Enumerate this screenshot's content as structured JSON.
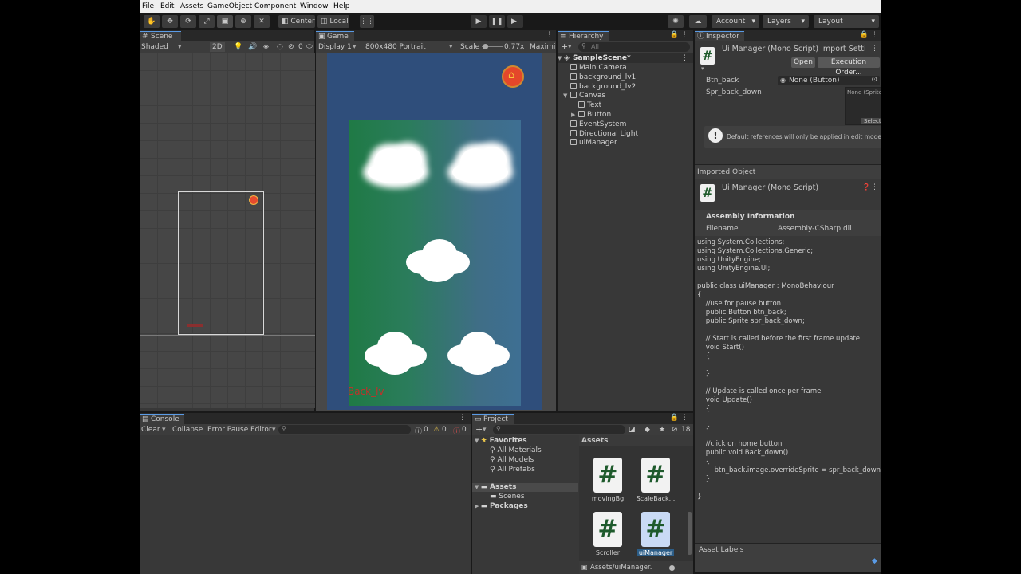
{
  "menu": [
    "File",
    "Edit",
    "Assets",
    "GameObject",
    "Component",
    "Window",
    "Help"
  ],
  "toolbar": {
    "pivot": "Center",
    "space": "Local",
    "account": "Account",
    "layers": "Layers",
    "layout": "Layout"
  },
  "scene": {
    "tab": "Scene",
    "shading": "Shaded",
    "mode_2d": "2D",
    "gizmo_count": "0"
  },
  "game": {
    "tab": "Game",
    "display": "Display 1",
    "resolution": "800x480 Portrait",
    "scale_label": "Scale",
    "scale_value": "0.77x",
    "maximize": "Maximi",
    "back_label": "Back_lv"
  },
  "hierarchy": {
    "tab": "Hierarchy",
    "search_placeholder": "All",
    "scene_name": "SampleScene*",
    "items": [
      {
        "label": "Main Camera",
        "depth": 1,
        "expand": ""
      },
      {
        "label": "background_lv1",
        "depth": 1,
        "expand": ""
      },
      {
        "label": "background_lv2",
        "depth": 1,
        "expand": ""
      },
      {
        "label": "Canvas",
        "depth": 1,
        "expand": "▼"
      },
      {
        "label": "Text",
        "depth": 2,
        "expand": ""
      },
      {
        "label": "Button",
        "depth": 2,
        "expand": "▶"
      },
      {
        "label": "EventSystem",
        "depth": 1,
        "expand": ""
      },
      {
        "label": "Directional Light",
        "depth": 1,
        "expand": ""
      },
      {
        "label": "uiManager",
        "depth": 1,
        "expand": ""
      }
    ]
  },
  "inspector": {
    "tab": "Inspector",
    "title": "Ui Manager (Mono Script) Import Setti",
    "open_button": "Open",
    "exec_order_button": "Execution Order...",
    "field_btn_back": "Btn_back",
    "field_btn_back_value": "None (Button)",
    "field_spr": "Spr_back_down",
    "sprite_none": "None (Sprite)",
    "sprite_select": "Select",
    "help_text": "Default references will only be applied in edit mode.",
    "imported_object": "Imported Object",
    "imported_title": "Ui Manager (Mono Script)",
    "assembly_info": "Assembly Information",
    "filename_label": "Filename",
    "filename_value": "Assembly-CSharp.dll",
    "code": [
      "using System.Collections;",
      "using System.Collections.Generic;",
      "using UnityEngine;",
      "using UnityEngine.UI;",
      "",
      "public class uiManager : MonoBehaviour",
      "{",
      "    //use for pause button",
      "    public Button btn_back;",
      "    public Sprite spr_back_down;",
      "",
      "    // Start is called before the first frame update",
      "    void Start()",
      "    {",
      "",
      "    }",
      "",
      "    // Update is called once per frame",
      "    void Update()",
      "    {",
      "",
      "    }",
      "",
      "    //click on home button",
      "    public void Back_down()",
      "    {",
      "        btn_back.image.overrideSprite = spr_back_down;",
      "    }",
      "",
      "}"
    ],
    "asset_labels": "Asset Labels"
  },
  "console": {
    "tab": "Console",
    "clear": "Clear",
    "collapse": "Collapse",
    "error_pause": "Error Pause",
    "editor": "Editor",
    "count_log": "0",
    "count_warn": "0",
    "count_err": "0"
  },
  "project": {
    "tab": "Project",
    "hidden_count": "18",
    "favorites": "Favorites",
    "fav_items": [
      "All Materials",
      "All Models",
      "All Prefabs"
    ],
    "assets_root": "Assets",
    "scenes": "Scenes",
    "packages": "Packages",
    "assets_header": "Assets",
    "files": [
      {
        "name": "movingBg",
        "selected": false
      },
      {
        "name": "ScaleBack...",
        "selected": false
      },
      {
        "name": "Scroller",
        "selected": false
      },
      {
        "name": "uiManager",
        "selected": true
      }
    ],
    "path": "Assets/uiManager."
  }
}
